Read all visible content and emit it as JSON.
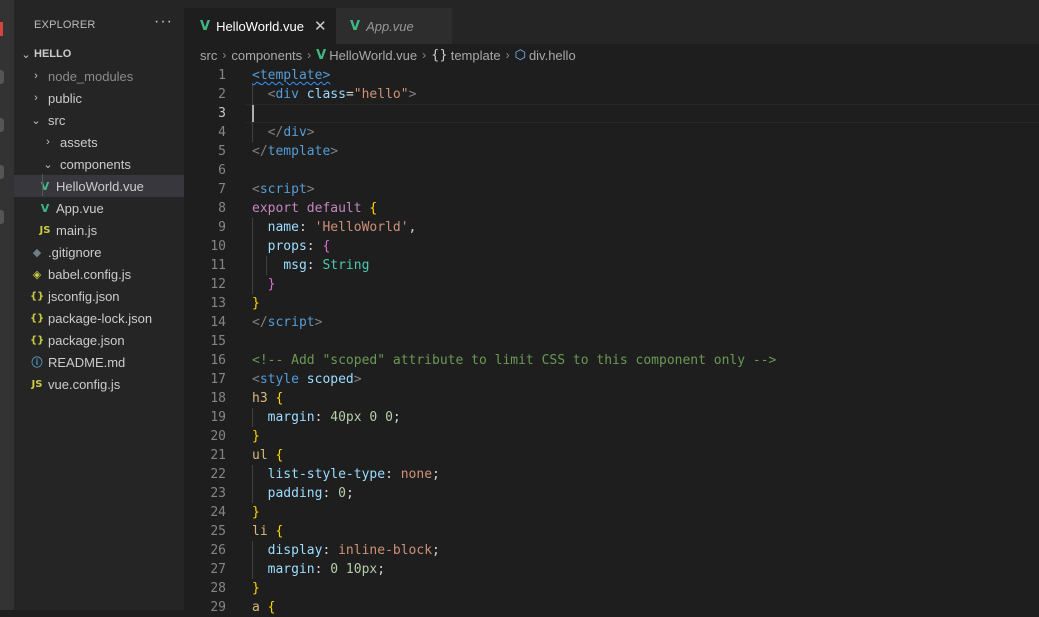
{
  "explorer": {
    "title": "EXPLORER",
    "more": "···",
    "project": "HELLO",
    "items": [
      {
        "label": "node_modules",
        "chev": "›",
        "icon": "",
        "iconName": "chevron-right-icon",
        "dim": true
      },
      {
        "label": "public",
        "chev": "›",
        "icon": "",
        "iconName": "chevron-right-icon"
      },
      {
        "label": "src",
        "chev": "⌄",
        "icon": "",
        "iconName": "chevron-down-icon"
      },
      {
        "label": "assets",
        "chev": "›",
        "icon": "",
        "iconName": "chevron-right-icon"
      },
      {
        "label": "components",
        "chev": "⌄",
        "icon": "",
        "iconName": "chevron-down-icon"
      },
      {
        "label": "HelloWorld.vue",
        "icon": "V",
        "iconName": "vue-file-icon",
        "selected": true
      },
      {
        "label": "App.vue",
        "icon": "V",
        "iconName": "vue-file-icon"
      },
      {
        "label": "main.js",
        "icon": "JS",
        "iconName": "js-file-icon"
      },
      {
        "label": ".gitignore",
        "icon": "◆",
        "iconName": "git-file-icon"
      },
      {
        "label": "babel.config.js",
        "icon": "◈",
        "iconName": "babel-file-icon"
      },
      {
        "label": "jsconfig.json",
        "icon": "{}",
        "iconName": "json-file-icon"
      },
      {
        "label": "package-lock.json",
        "icon": "{}",
        "iconName": "json-file-icon"
      },
      {
        "label": "package.json",
        "icon": "{}",
        "iconName": "json-file-icon"
      },
      {
        "label": "README.md",
        "icon": "ⓘ",
        "iconName": "info-file-icon"
      },
      {
        "label": "vue.config.js",
        "icon": "JS",
        "iconName": "js-file-icon"
      }
    ]
  },
  "tabs": [
    {
      "label": "HelloWorld.vue",
      "icon": "V",
      "close": "✕",
      "active": true
    },
    {
      "label": "App.vue",
      "icon": "V",
      "active": false
    }
  ],
  "breadcrumb": [
    {
      "label": "src",
      "icon": ""
    },
    {
      "label": "components",
      "icon": ""
    },
    {
      "label": "HelloWorld.vue",
      "icon": "V"
    },
    {
      "label": "template",
      "icon": "{}"
    },
    {
      "label": "div.hello",
      "icon": "⬡"
    }
  ],
  "editor": {
    "currentLine": 3,
    "lines": [
      {
        "n": "1",
        "t": [
          [
            "<",
            "t-tag wavy"
          ],
          [
            "template",
            "t-tag wavy"
          ],
          [
            ">",
            "t-tag wavy"
          ]
        ]
      },
      {
        "n": "2",
        "t": [
          [
            "  ",
            ""
          ],
          [
            "<",
            "t-punc"
          ],
          [
            "div",
            "t-tag"
          ],
          [
            " ",
            ""
          ],
          [
            "class",
            "t-attr"
          ],
          [
            "=",
            "t-text"
          ],
          [
            "\"hello\"",
            "t-str"
          ],
          [
            ">",
            "t-punc"
          ]
        ]
      },
      {
        "n": "3",
        "t": []
      },
      {
        "n": "4",
        "t": [
          [
            "  ",
            ""
          ],
          [
            "</",
            "t-punc"
          ],
          [
            "div",
            "t-tag"
          ],
          [
            ">",
            "t-punc"
          ]
        ]
      },
      {
        "n": "5",
        "t": [
          [
            "</",
            "t-punc"
          ],
          [
            "template",
            "t-tag"
          ],
          [
            ">",
            "t-punc"
          ]
        ]
      },
      {
        "n": "6",
        "t": []
      },
      {
        "n": "7",
        "t": [
          [
            "<",
            "t-punc"
          ],
          [
            "script",
            "t-tag"
          ],
          [
            ">",
            "t-punc"
          ]
        ]
      },
      {
        "n": "8",
        "t": [
          [
            "export",
            "t-kw"
          ],
          [
            " ",
            ""
          ],
          [
            "default",
            "t-kw"
          ],
          [
            " ",
            ""
          ],
          [
            "{",
            "t-brace"
          ]
        ]
      },
      {
        "n": "9",
        "t": [
          [
            "  ",
            ""
          ],
          [
            "name",
            "t-attr"
          ],
          [
            ": ",
            "t-text"
          ],
          [
            "'HelloWorld'",
            "t-str"
          ],
          [
            ",",
            "t-text"
          ]
        ]
      },
      {
        "n": "10",
        "t": [
          [
            "  ",
            ""
          ],
          [
            "props",
            "t-attr"
          ],
          [
            ": ",
            "t-text"
          ],
          [
            "{",
            "t-brace2"
          ]
        ]
      },
      {
        "n": "11",
        "t": [
          [
            "    ",
            ""
          ],
          [
            "msg",
            "t-attr"
          ],
          [
            ": ",
            "t-text"
          ],
          [
            "String",
            "t-cls"
          ]
        ]
      },
      {
        "n": "12",
        "t": [
          [
            "  ",
            ""
          ],
          [
            "}",
            "t-brace2"
          ]
        ]
      },
      {
        "n": "13",
        "t": [
          [
            "}",
            "t-brace"
          ]
        ]
      },
      {
        "n": "14",
        "t": [
          [
            "</",
            "t-punc"
          ],
          [
            "script",
            "t-tag"
          ],
          [
            ">",
            "t-punc"
          ]
        ]
      },
      {
        "n": "15",
        "t": []
      },
      {
        "n": "16",
        "t": [
          [
            "<!-- Add \"scoped\" attribute to limit CSS to this component only -->",
            "t-com"
          ]
        ]
      },
      {
        "n": "17",
        "t": [
          [
            "<",
            "t-punc"
          ],
          [
            "style",
            "t-tag"
          ],
          [
            " ",
            ""
          ],
          [
            "scoped",
            "t-attr"
          ],
          [
            ">",
            "t-punc"
          ]
        ]
      },
      {
        "n": "18",
        "t": [
          [
            "h3",
            "t-sel"
          ],
          [
            " ",
            ""
          ],
          [
            "{",
            "t-brace"
          ]
        ]
      },
      {
        "n": "19",
        "t": [
          [
            "  ",
            ""
          ],
          [
            "margin",
            "t-attr"
          ],
          [
            ": ",
            "t-text"
          ],
          [
            "40px 0 0",
            "t-num"
          ],
          [
            ";",
            "t-text"
          ]
        ]
      },
      {
        "n": "20",
        "t": [
          [
            "}",
            "t-brace"
          ]
        ]
      },
      {
        "n": "21",
        "t": [
          [
            "ul",
            "t-sel"
          ],
          [
            " ",
            ""
          ],
          [
            "{",
            "t-brace"
          ]
        ]
      },
      {
        "n": "22",
        "t": [
          [
            "  ",
            ""
          ],
          [
            "list-style-type",
            "t-attr"
          ],
          [
            ": ",
            "t-text"
          ],
          [
            "none",
            "t-str"
          ],
          [
            ";",
            "t-text"
          ]
        ]
      },
      {
        "n": "23",
        "t": [
          [
            "  ",
            ""
          ],
          [
            "padding",
            "t-attr"
          ],
          [
            ": ",
            "t-text"
          ],
          [
            "0",
            "t-num"
          ],
          [
            ";",
            "t-text"
          ]
        ]
      },
      {
        "n": "24",
        "t": [
          [
            "}",
            "t-brace"
          ]
        ]
      },
      {
        "n": "25",
        "t": [
          [
            "li",
            "t-sel"
          ],
          [
            " ",
            ""
          ],
          [
            "{",
            "t-brace"
          ]
        ]
      },
      {
        "n": "26",
        "t": [
          [
            "  ",
            ""
          ],
          [
            "display",
            "t-attr"
          ],
          [
            ": ",
            "t-text"
          ],
          [
            "inline-block",
            "t-str"
          ],
          [
            ";",
            "t-text"
          ]
        ]
      },
      {
        "n": "27",
        "t": [
          [
            "  ",
            ""
          ],
          [
            "margin",
            "t-attr"
          ],
          [
            ": ",
            "t-text"
          ],
          [
            "0 10px",
            "t-num"
          ],
          [
            ";",
            "t-text"
          ]
        ]
      },
      {
        "n": "28",
        "t": [
          [
            "}",
            "t-brace"
          ]
        ]
      },
      {
        "n": "29",
        "t": [
          [
            "a",
            "t-sel"
          ],
          [
            " ",
            ""
          ],
          [
            "{",
            "t-brace"
          ]
        ]
      }
    ]
  },
  "colors": {
    "vue": "#41b883",
    "json": "#cbcb41",
    "js": "#cbcb41",
    "info": "#519aba",
    "git": "#6d8086",
    "babel": "#cbcb41"
  }
}
